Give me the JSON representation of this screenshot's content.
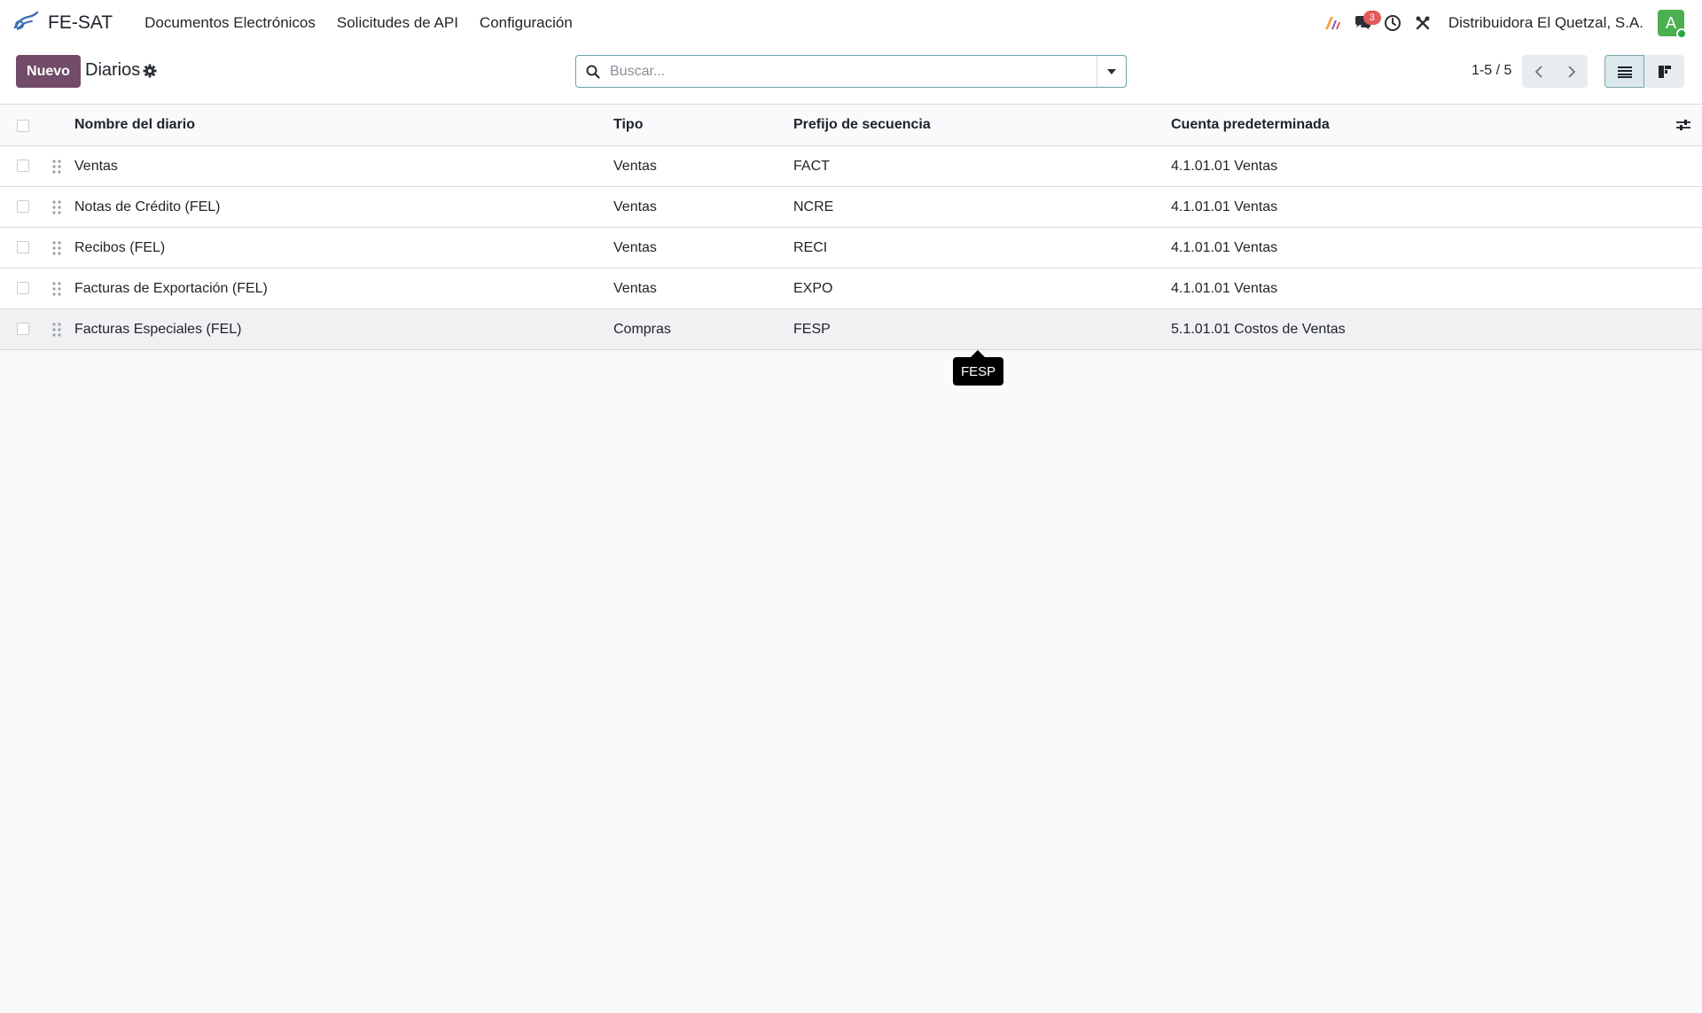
{
  "navbar": {
    "app_name": "FE-SAT",
    "menu": [
      "Documentos Electrónicos",
      "Solicitudes de API",
      "Configuración"
    ],
    "messages_badge": "3",
    "company": "Distribuidora El Quetzal, S.A.",
    "avatar_letter": "A",
    "icons": [
      "app-logo-icon",
      "ai-assistant-icon",
      "messages-icon",
      "activity-clock-icon",
      "debug-tools-icon"
    ]
  },
  "control": {
    "new_label": "Nuevo",
    "breadcrumb": "Diarios",
    "search_placeholder": "Buscar...",
    "pager": "1-5 / 5"
  },
  "table": {
    "columns": [
      "Nombre del diario",
      "Tipo",
      "Prefijo de secuencia",
      "Cuenta predeterminada"
    ],
    "rows": [
      {
        "name": "Ventas",
        "type": "Ventas",
        "prefix": "FACT",
        "account": "4.1.01.01 Ventas"
      },
      {
        "name": "Notas de Crédito (FEL)",
        "type": "Ventas",
        "prefix": "NCRE",
        "account": "4.1.01.01 Ventas"
      },
      {
        "name": "Recibos (FEL)",
        "type": "Ventas",
        "prefix": "RECI",
        "account": "4.1.01.01 Ventas"
      },
      {
        "name": "Facturas de Exportación (FEL)",
        "type": "Ventas",
        "prefix": "EXPO",
        "account": "4.1.01.01 Ventas"
      },
      {
        "name": "Facturas Especiales (FEL)",
        "type": "Compras",
        "prefix": "FESP",
        "account": "5.1.01.01 Costos de Ventas"
      }
    ]
  },
  "tooltip": "FESP",
  "colors": {
    "primary": "#714b67",
    "badge": "#e25a5a",
    "avatar": "#4caf50",
    "search_border": "#6aa3a9"
  }
}
